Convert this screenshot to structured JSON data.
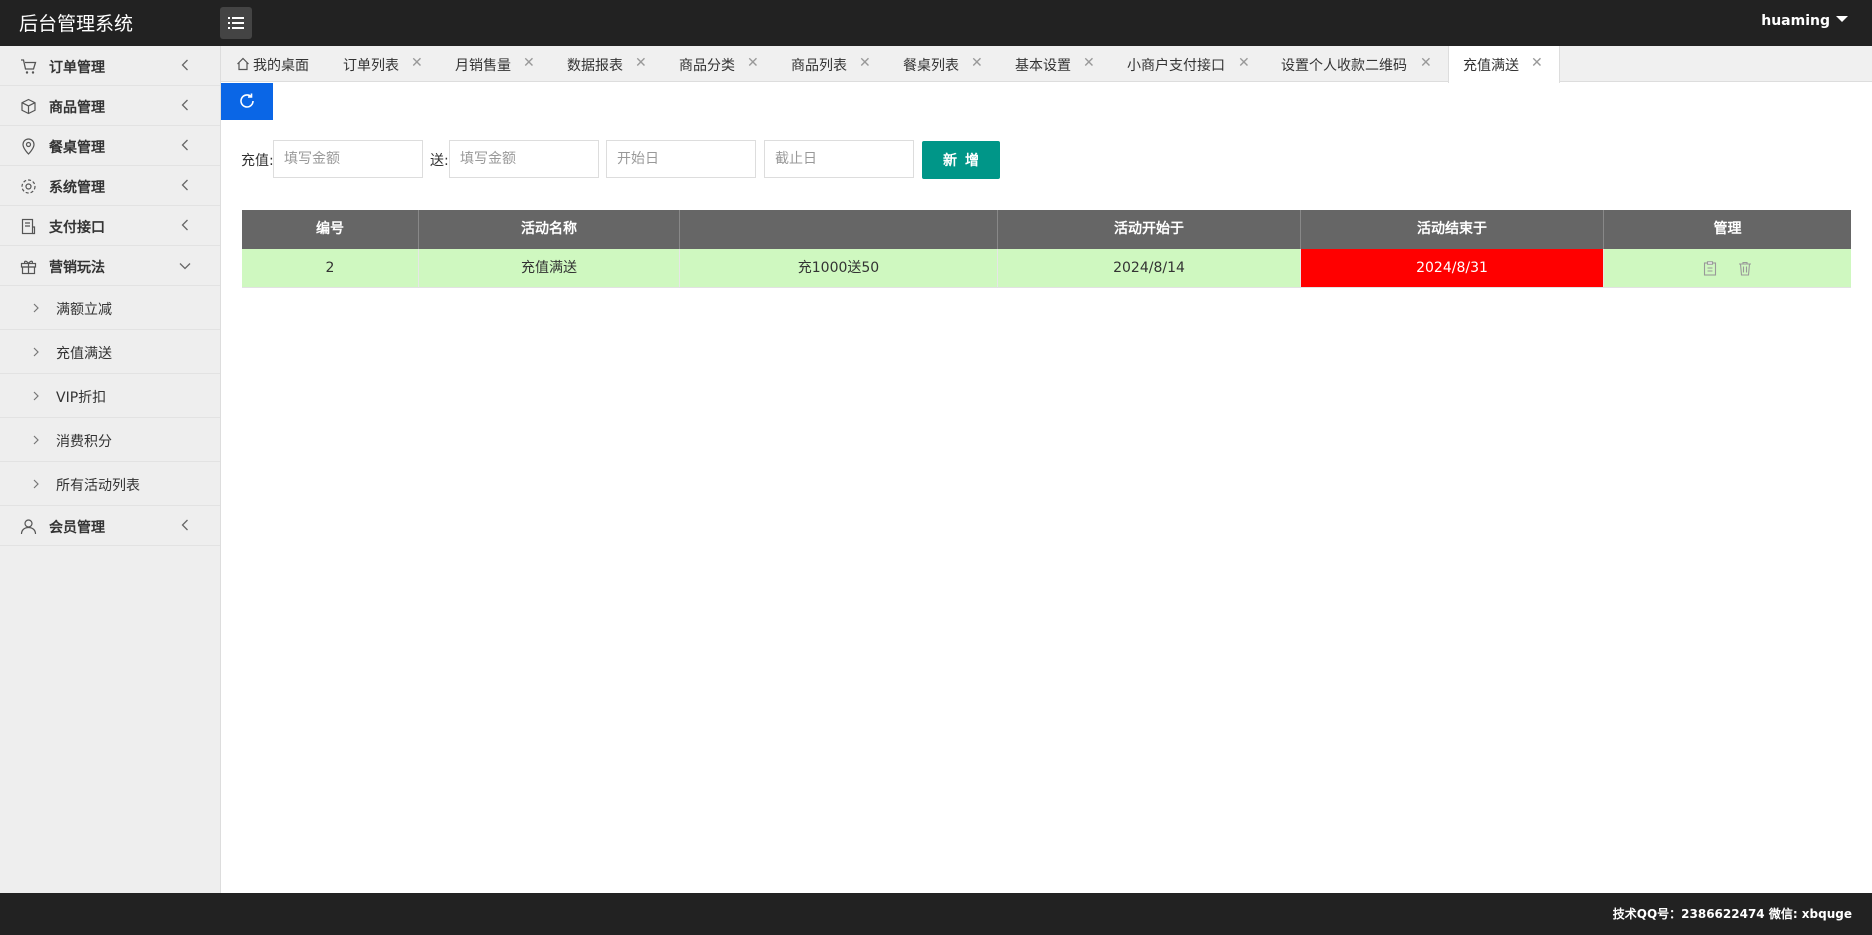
{
  "header": {
    "brand": "后台管理系统",
    "user": "huaming"
  },
  "sidebar": {
    "items": [
      {
        "label": "订单管理",
        "icon": "cart-icon"
      },
      {
        "label": "商品管理",
        "icon": "box-icon"
      },
      {
        "label": "餐桌管理",
        "icon": "location-icon"
      },
      {
        "label": "系统管理",
        "icon": "gear-icon"
      },
      {
        "label": "支付接口",
        "icon": "receipt-icon"
      },
      {
        "label": "营销玩法",
        "icon": "gift-icon"
      }
    ],
    "sub_items": [
      {
        "label": "满额立减"
      },
      {
        "label": "充值满送"
      },
      {
        "label": "VIP折扣"
      },
      {
        "label": "消费积分"
      },
      {
        "label": "所有活动列表"
      }
    ],
    "last_item": {
      "label": "会员管理",
      "icon": "user-icon"
    }
  },
  "tabs": [
    {
      "label": "我的桌面"
    },
    {
      "label": "订单列表"
    },
    {
      "label": "月销售量"
    },
    {
      "label": "数据报表"
    },
    {
      "label": "商品分类"
    },
    {
      "label": "商品列表"
    },
    {
      "label": "餐桌列表"
    },
    {
      "label": "基本设置"
    },
    {
      "label": "小商户支付接口"
    },
    {
      "label": "设置个人收款二维码"
    },
    {
      "label": "充值满送"
    }
  ],
  "form": {
    "recharge_label": "充值:",
    "recharge_placeholder": "填写金额",
    "gift_label": "送:",
    "gift_placeholder": "填写金额",
    "start_placeholder": "开始日",
    "end_placeholder": "截止日",
    "add_label": "新增"
  },
  "table": {
    "headers": [
      "编号",
      "活动名称",
      "",
      "活动开始于",
      "活动结束于",
      "管理"
    ],
    "rows": [
      {
        "id": "2",
        "name": "充值满送",
        "detail": "充1000送50",
        "start": "2024/8/14",
        "end": "2024/8/31"
      }
    ]
  },
  "footer": {
    "text": "技术QQ号：2386622474 微信: xbquge"
  },
  "colors": {
    "header_bg": "#222222",
    "refresh_btn": "#0a66e6",
    "add_btn": "#009688",
    "row_bg": "#cff8c0",
    "expired_bg": "#ff0000"
  }
}
